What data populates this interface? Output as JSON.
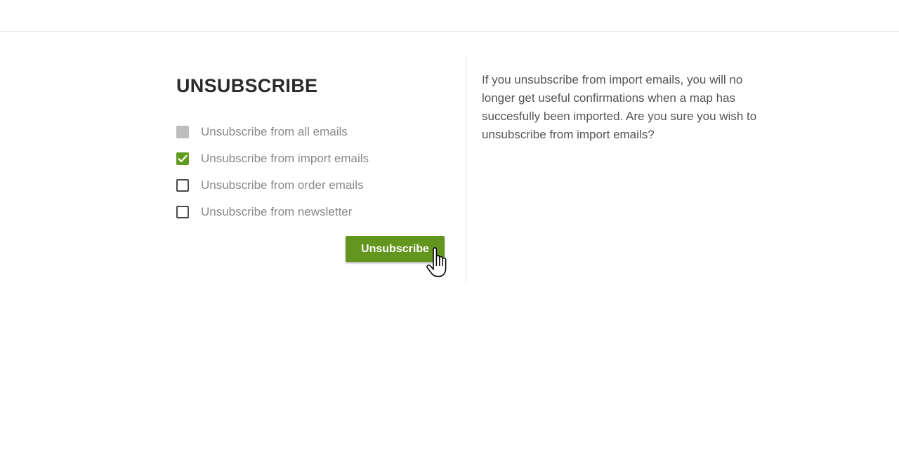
{
  "page": {
    "title": "UNSUBSCRIBE"
  },
  "options": [
    {
      "label": "Unsubscribe from all emails",
      "state": "disabled"
    },
    {
      "label": "Unsubscribe from import emails",
      "state": "checked"
    },
    {
      "label": "Unsubscribe from order emails",
      "state": "unchecked"
    },
    {
      "label": "Unsubscribe from newsletter",
      "state": "unchecked"
    }
  ],
  "actions": {
    "unsubscribe_label": "Unsubscribe"
  },
  "info": {
    "message": "If you unsubscribe from import emails, you will no longer get useful confirmations when a map has succesfully been imported. Are you sure you wish to unsubscribe from import emails?"
  },
  "colors": {
    "accent": "#62961f",
    "checked": "#5f9b1d",
    "disabled": "#bdbdbd",
    "text_muted": "#8a8a8a",
    "text_body": "#555555",
    "title": "#2b2b2b"
  },
  "icons": {
    "checkmark": "checkmark-icon",
    "cursor": "hand-pointer-cursor-icon"
  }
}
